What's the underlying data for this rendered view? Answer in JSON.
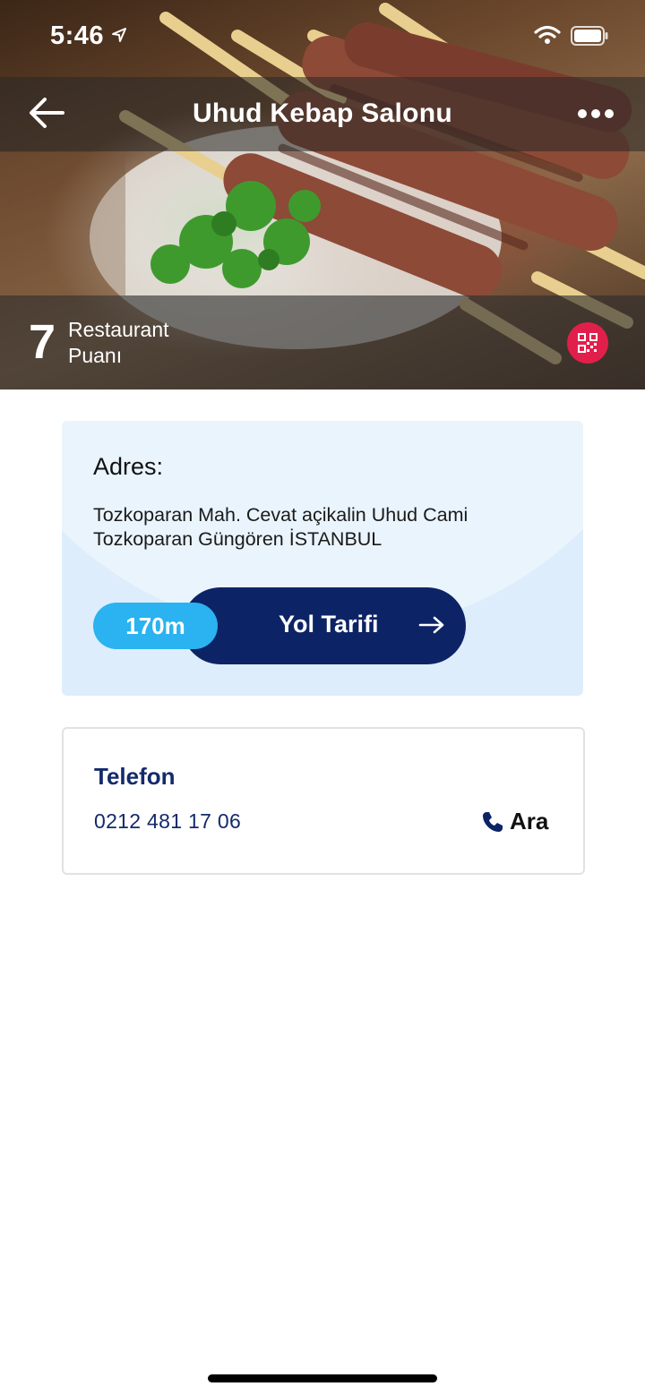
{
  "status_bar": {
    "time": "5:46"
  },
  "nav": {
    "title": "Uhud Kebap Salonu"
  },
  "rating": {
    "value": "7",
    "label_line1": "Restaurant",
    "label_line2": "Puanı"
  },
  "address": {
    "title": "Adres:",
    "line1": "Tozkoparan Mah. Cevat açikalin Uhud Cami",
    "line2": "Tozkoparan Güngören İSTANBUL",
    "distance": "170m",
    "directions_label": "Yol Tarifi"
  },
  "phone": {
    "title": "Telefon",
    "number": "0212 481 17 06",
    "call_label": "Ara"
  },
  "colors": {
    "navy": "#0c2466",
    "accent_blue": "#2bb2f0",
    "qr_red": "#e21f4b",
    "card_bg": "#deedfb"
  },
  "icons": [
    "location-arrow-icon",
    "wifi-icon",
    "battery-icon",
    "back-arrow-icon",
    "more-icon",
    "qr-code-icon",
    "arrow-right-icon",
    "phone-icon"
  ]
}
